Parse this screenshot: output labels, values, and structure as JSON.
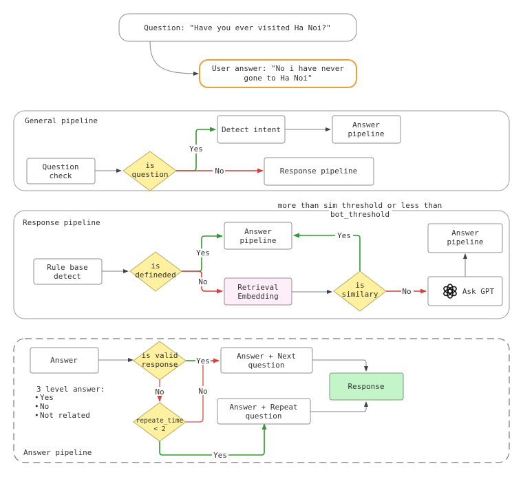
{
  "top": {
    "question": "Question: \"Have you ever visited Ha Noi?\"",
    "user_answer_line1": "User answer: \"No i have never",
    "user_answer_line2": "gone to Ha Noi\"",
    "accent_orange": "#f0a030"
  },
  "general": {
    "title": "General pipeline",
    "question_check": [
      "Question",
      "check"
    ],
    "decision": [
      "is",
      "question"
    ],
    "detect_intent": "Detect intent",
    "answer_pipeline": [
      "Answer",
      "pipeline"
    ],
    "response_pipeline": "Response pipeline",
    "yes": "Yes",
    "no": "No"
  },
  "response": {
    "title": "Response pipeline",
    "threshold_note": [
      "more than sim_threshold or less than",
      "bot_threshold"
    ],
    "rule_base": [
      "Rule base",
      "detect"
    ],
    "decision": [
      "is",
      "defineded"
    ],
    "answer_pipeline": [
      "Answer",
      "pipeline"
    ],
    "retrieval": [
      "Retrieval",
      "Embedding"
    ],
    "similar_decision": [
      "is",
      "similary"
    ],
    "ask_gpt": "Ask GPT",
    "answer_pipeline_2": [
      "Answer",
      "pipeline"
    ],
    "yes": "Yes",
    "no": "No",
    "yes2": "Yes",
    "no2": "No",
    "retrieval_fill": "#fdeefa"
  },
  "answer": {
    "title": "Answer pipeline",
    "answer_box": "Answer",
    "levels_title": "3 level answer:",
    "levels": [
      "Yes",
      "No",
      "Not related"
    ],
    "valid_decision": [
      "is valid",
      "response"
    ],
    "repeat_decision": [
      "repeate_time",
      "< 2"
    ],
    "next_question": [
      "Answer + Next",
      "question"
    ],
    "repeat_question": [
      "Answer + Repeat",
      "question"
    ],
    "response": "Response",
    "yes": "Yes",
    "no": "No",
    "no2": "No",
    "yes2": "Yes",
    "response_fill": "#c4f5c8"
  }
}
